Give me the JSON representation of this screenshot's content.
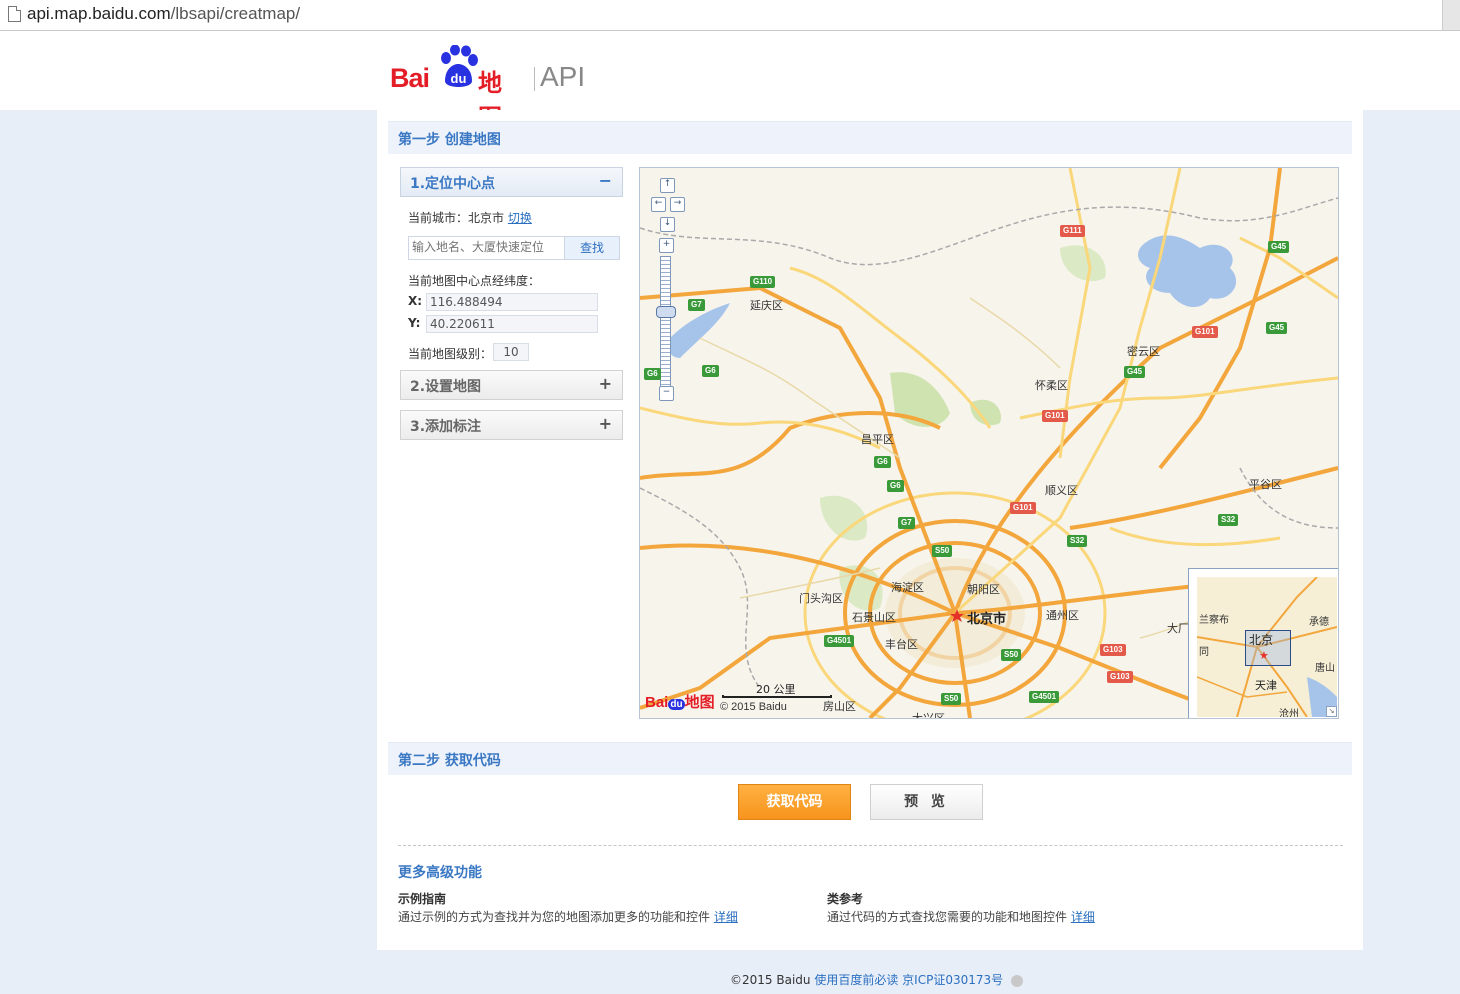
{
  "browser": {
    "url_host": "api.map.baidu.com",
    "url_path": "/lbsapi/creatmap/"
  },
  "header": {
    "logo_bai": "Bai",
    "logo_du": "du",
    "logo_ditu": "地图",
    "logo_api": "API"
  },
  "step1": {
    "title": "第一步 创建地图",
    "locate": {
      "label": "1.定位中心点",
      "toggle": "−",
      "current_city_label": "当前城市：北京市",
      "switch_link": "切换",
      "search_placeholder": "输入地名、大厦快速定位",
      "search_button": "查找",
      "center_label": "当前地图中心点经纬度：",
      "x_label": "X:",
      "x_value": "116.488494",
      "y_label": "Y:",
      "y_value": "40.220611",
      "level_label": "当前地图级别：",
      "level_value": "10"
    },
    "settings": {
      "label": "2.设置地图",
      "toggle": "+"
    },
    "markers": {
      "label": "3.添加标注",
      "toggle": "+"
    }
  },
  "map": {
    "zoom_in": "+",
    "zoom_out": "−",
    "pan_up": "↑",
    "pan_left": "←",
    "pan_right": "→",
    "pan_down": "↓",
    "places": {
      "yanqing": "延庆区",
      "miyun": "密云区",
      "huairou": "怀柔区",
      "changping": "昌平区",
      "shunyi": "顺义区",
      "pinggu": "平谷区",
      "haidian": "海淀区",
      "chaoyang": "朝阳区",
      "mentougou": "门头沟区",
      "shijingshan": "石景山区",
      "beijing": "北京市",
      "tongzhou": "通州区",
      "fengtai": "丰台区",
      "fangshan": "房山区",
      "daxing": "大兴区",
      "dachang": "大厂"
    },
    "shields": {
      "g111": "G111",
      "g45a": "G45",
      "g45b": "G45",
      "g45c": "G45",
      "g110": "G110",
      "g7a": "G7",
      "g101a": "G101",
      "g6a": "G6",
      "g6b": "G6",
      "g101b": "G101",
      "g6c": "G6",
      "g6d": "G6",
      "g7b": "G7",
      "g101c": "G101",
      "s32a": "S32",
      "s32b": "S32",
      "s50a": "S50",
      "g4501a": "G4501",
      "s50b": "S50",
      "g103a": "G103",
      "g103b": "G103",
      "s50c": "S50",
      "g4501b": "G4501"
    },
    "scale_label": "20 公里",
    "copyright": "© 2015 Baidu",
    "logo_bai": "Bai",
    "logo_du": "du",
    "logo_ditu": "地图",
    "overview": {
      "beijing": "北京",
      "chengde": "承德",
      "tianjin": "天津",
      "tangshan": "唐山",
      "cangzhou": "沧州",
      "lanchabu": "兰察布",
      "tong": "同"
    },
    "colors": {
      "land": "#f7f4ec",
      "water": "#a6c3ea",
      "green": "#cfe3b0",
      "highway": "#f3a63c",
      "road": "#fad77a"
    }
  },
  "step2": {
    "title": "第二步 获取代码",
    "get_code_button": "获取代码",
    "preview_button": "预 览"
  },
  "more": {
    "title": "更多高级功能",
    "guide_title": "示例指南",
    "guide_desc": "通过示例的方式为查找并为您的地图添加更多的功能和控件",
    "guide_link": "详细",
    "ref_title": "类参考",
    "ref_desc": "通过代码的方式查找您需要的功能和地图控件",
    "ref_link": "详细"
  },
  "footer": {
    "copyright": "©2015 Baidu",
    "must_read": "使用百度前必读",
    "icp": "京ICP证030173号"
  }
}
